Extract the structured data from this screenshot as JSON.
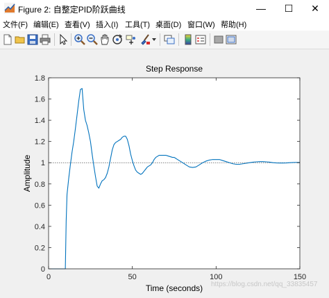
{
  "window": {
    "title": "Figure 2: 自整定PID阶跃曲线",
    "minimize_glyph": "—",
    "maximize_glyph": "☐",
    "close_glyph": "✕"
  },
  "menu": [
    {
      "id": "file",
      "label": "文件(F)"
    },
    {
      "id": "edit",
      "label": "编辑(E)"
    },
    {
      "id": "view",
      "label": "查看(V)"
    },
    {
      "id": "insert",
      "label": "插入(I)"
    },
    {
      "id": "tools",
      "label": "工具(T)"
    },
    {
      "id": "desktop",
      "label": "桌面(D)"
    },
    {
      "id": "window",
      "label": "窗口(W)"
    },
    {
      "id": "help",
      "label": "帮助(H)"
    }
  ],
  "toolbar_icons": [
    "new-figure-icon",
    "open-file-icon",
    "save-icon",
    "print-icon",
    "pointer-icon",
    "zoom-in-icon",
    "zoom-out-icon",
    "pan-icon",
    "rotate-3d-icon",
    "data-cursor-icon",
    "brush-icon",
    "link-plot-icon",
    "insert-colorbar-icon",
    "insert-legend-icon",
    "hide-plot-tools-icon",
    "show-plot-tools-icon"
  ],
  "chart_data": {
    "type": "line",
    "title": "Step Response",
    "xlabel": "Time (seconds)",
    "ylabel": "Amplitude",
    "xlim": [
      0,
      150
    ],
    "ylim": [
      0,
      1.8
    ],
    "xticks": [
      0,
      50,
      100,
      150
    ],
    "yticks": [
      0,
      0.2,
      0.4,
      0.6,
      0.8,
      1,
      1.2,
      1.4,
      1.6,
      1.8
    ],
    "xtick_labels": [
      "0",
      "50",
      "100",
      "150"
    ],
    "ytick_labels": [
      "0",
      "0.2",
      "0.4",
      "0.6",
      "0.8",
      "1",
      "1.2",
      "1.4",
      "1.6",
      "1.8"
    ],
    "reference_line": 1,
    "grid": false,
    "series": [
      {
        "color": "#0072bd",
        "x": [
          0,
          10,
          10.5,
          11,
          12,
          13,
          14,
          15,
          16,
          17,
          18,
          19,
          20,
          21,
          22,
          23,
          24,
          25,
          26,
          27,
          28,
          29,
          30,
          31,
          32,
          33,
          34,
          35,
          36,
          37,
          38,
          39,
          40,
          41,
          42,
          43,
          44,
          45,
          46,
          47,
          48,
          49,
          50,
          51,
          52,
          53,
          54,
          55,
          56,
          57,
          58,
          59,
          60,
          61,
          62,
          63,
          64,
          65,
          66,
          67,
          68,
          69,
          70,
          71,
          72,
          73,
          74,
          75,
          76,
          78,
          80,
          82,
          84,
          86,
          88,
          90,
          92,
          94,
          96,
          98,
          100,
          102,
          104,
          106,
          108,
          110,
          112,
          114,
          116,
          118,
          120,
          122,
          124,
          126,
          128,
          130,
          132,
          134,
          136,
          138,
          140,
          142,
          144,
          146,
          148,
          150
        ],
        "y": [
          0,
          0,
          0.45,
          0.7,
          0.85,
          0.98,
          1.1,
          1.2,
          1.32,
          1.45,
          1.58,
          1.69,
          1.7,
          1.5,
          1.4,
          1.35,
          1.28,
          1.2,
          1.08,
          0.97,
          0.87,
          0.78,
          0.76,
          0.8,
          0.83,
          0.84,
          0.86,
          0.9,
          0.96,
          1.04,
          1.12,
          1.17,
          1.19,
          1.2,
          1.21,
          1.22,
          1.24,
          1.25,
          1.25,
          1.22,
          1.16,
          1.08,
          1.02,
          0.97,
          0.93,
          0.91,
          0.9,
          0.89,
          0.9,
          0.92,
          0.94,
          0.96,
          0.97,
          0.98,
          1.0,
          1.03,
          1.05,
          1.06,
          1.07,
          1.07,
          1.07,
          1.07,
          1.07,
          1.065,
          1.06,
          1.055,
          1.05,
          1.05,
          1.04,
          1.02,
          1.0,
          0.98,
          0.96,
          0.955,
          0.96,
          0.98,
          1.0,
          1.015,
          1.025,
          1.03,
          1.03,
          1.03,
          1.02,
          1.01,
          1.0,
          0.99,
          0.985,
          0.985,
          0.99,
          0.995,
          1.0,
          1.005,
          1.008,
          1.01,
          1.01,
          1.008,
          1.005,
          1.0,
          0.998,
          0.997,
          0.997,
          0.998,
          1.0,
          1.002,
          1.003,
          1.003
        ]
      }
    ]
  },
  "watermark": "https://blog.csdn.net/qq_33835457"
}
